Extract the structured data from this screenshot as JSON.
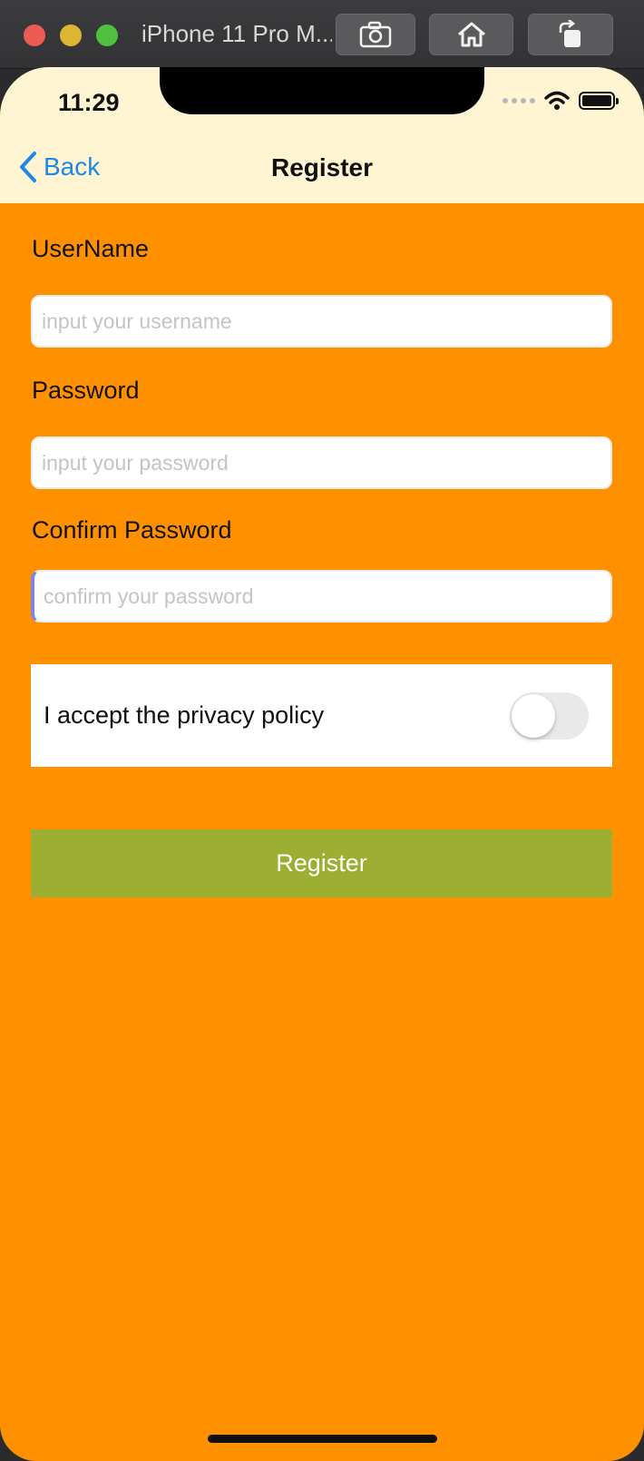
{
  "window": {
    "title": "iPhone 11 Pro M...",
    "buttons": [
      "screenshot-icon",
      "home-icon",
      "rotate-icon"
    ]
  },
  "status_bar": {
    "time": "11:29",
    "icons": [
      "signal-dots-icon",
      "wifi-icon",
      "battery-icon"
    ]
  },
  "nav": {
    "back_label": "Back",
    "title": "Register"
  },
  "form": {
    "username_label": "UserName",
    "username_placeholder": "input your username",
    "username_value": "",
    "password_label": "Password",
    "password_placeholder": "input your password",
    "password_value": "",
    "confirm_label": "Confirm Password",
    "confirm_placeholder": "confirm your password",
    "confirm_value": "",
    "policy_label": "I accept the privacy policy",
    "policy_accepted": false,
    "register_label": "Register"
  },
  "colors": {
    "background": "#ff9100",
    "nav_background": "#fff5d2",
    "accent": "#1e88e5",
    "button": "#9caf32"
  }
}
